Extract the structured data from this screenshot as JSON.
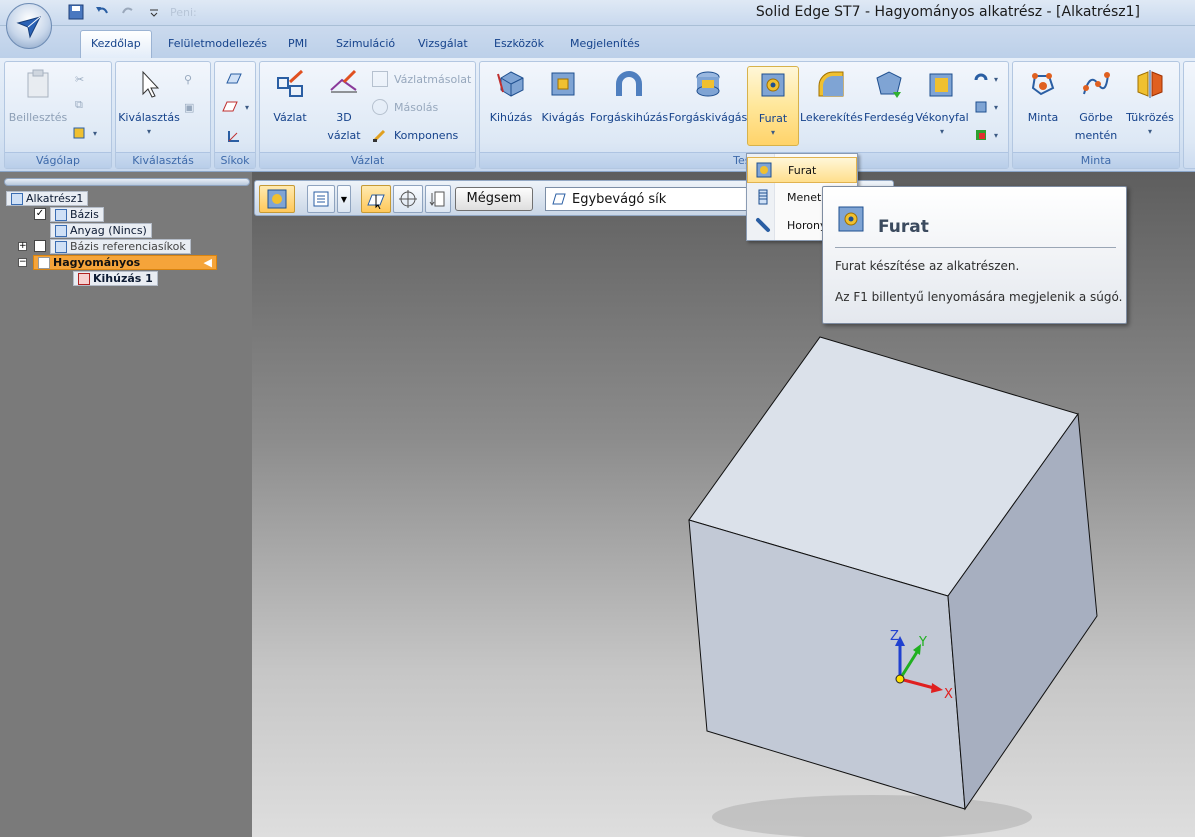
{
  "window": {
    "title": "Solid Edge ST7 - Hagyományos alkatrész - [Alkatrész1]"
  },
  "qat": {
    "items": [
      "save-icon",
      "undo-icon",
      "redo-icon",
      "customize-icon"
    ],
    "faded_label": "Peni:"
  },
  "tabs": [
    "Kezdőlap",
    "Felületmodellezés",
    "PMI",
    "Szimuláció",
    "Vizsgálat",
    "Eszközök",
    "Megjelenítés"
  ],
  "active_tab": "Kezdőlap",
  "ribbon": {
    "groups": {
      "vagolap": "Vágólap",
      "kivalasztas": "Kiválasztás",
      "sikok": "Síkok",
      "vazlat": "Vázlat",
      "test": "Test",
      "minta": "Minta"
    },
    "buttons": {
      "beillesztes": "Beillesztés",
      "kivalasztas": "Kiválasztás",
      "vazlat": "Vázlat",
      "vazlat3d_1": "3D",
      "vazlat3d_2": "vázlat",
      "vazlatmasolat": "Vázlatmásolat",
      "masolas": "Másolás",
      "komponens": "Komponens",
      "kihuzas": "Kihúzás",
      "kivagas": "Kivágás",
      "forgaskihuzas": "Forgáskihúzás",
      "forgaskivagas": "Forgáskivágás",
      "furat": "Furat",
      "lekerekites": "Lekerekítés",
      "ferdeseg": "Ferdeség",
      "vekonyfal": "Vékonyfal",
      "minta": "Minta",
      "gorbe_1": "Görbe",
      "gorbe_2": "mentén",
      "tukrozes": "Tükrözés"
    }
  },
  "tree": {
    "root": "Alkatrész1",
    "items": [
      "Bázis",
      "Anyag (Nincs)",
      "Bázis referenciasíkok",
      "Hagyományos",
      "Kihúzás 1"
    ]
  },
  "command_bar": {
    "cancel_label": "Mégsem",
    "plane_option": "Egybevágó sík"
  },
  "dropdown": {
    "items": [
      "Furat",
      "Menet",
      "Horony"
    ]
  },
  "tooltip": {
    "title": "Furat",
    "description": "Furat készítése az alkatrészen.",
    "help": "Az F1 billentyű lenyomására megjelenik a súgó."
  },
  "triad": {
    "x": "X",
    "y": "Y",
    "z": "Z"
  },
  "colors": {
    "accent": "#f5a43a",
    "ribbon_bg": "#d5e3f3",
    "x_axis": "#e02020",
    "y_axis": "#20b020",
    "z_axis": "#2040d0"
  }
}
